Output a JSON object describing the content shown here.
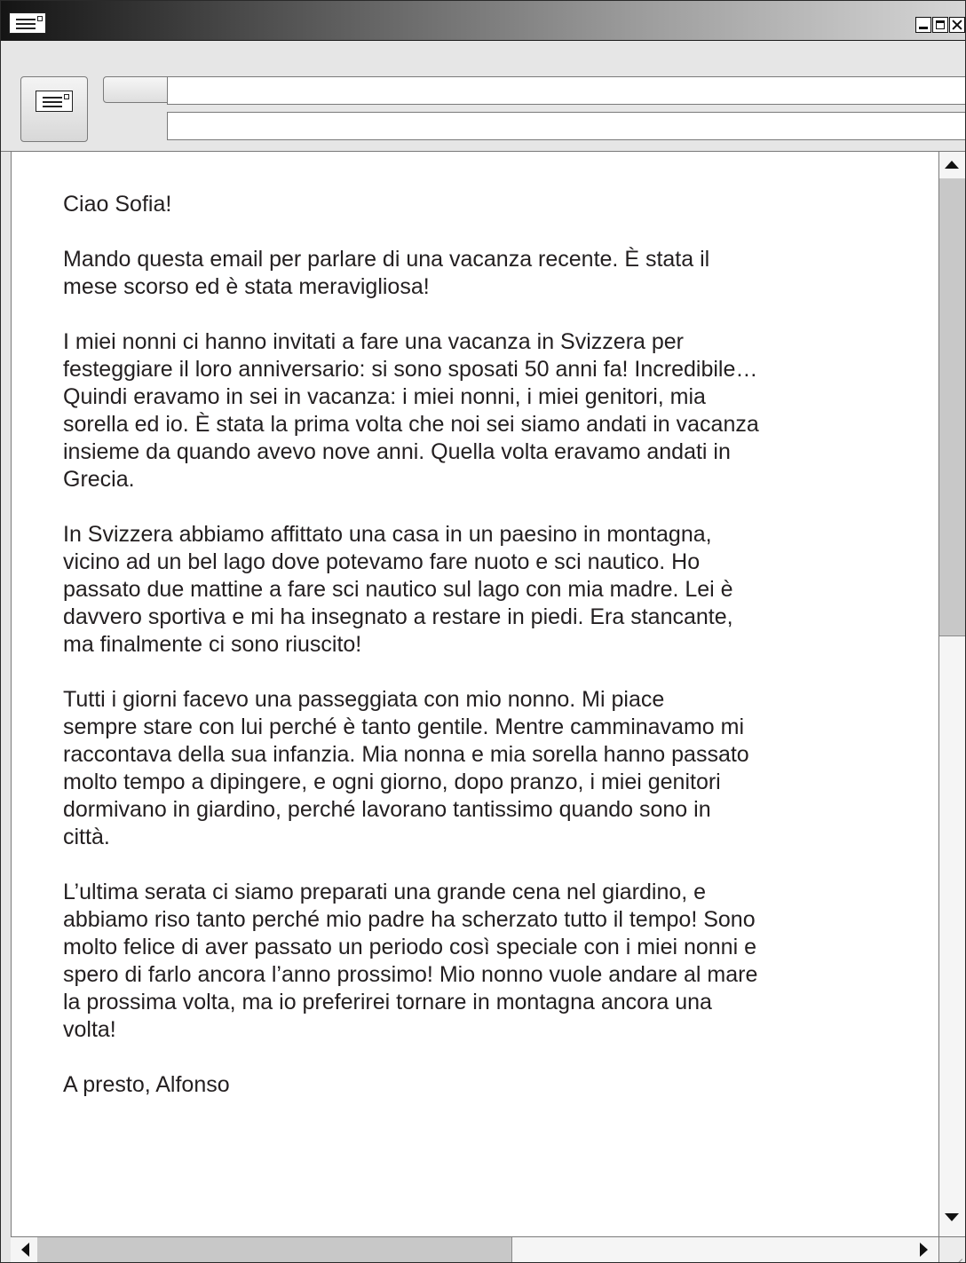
{
  "window": {
    "title": ""
  },
  "header": {
    "to_value": "",
    "subject_value": ""
  },
  "email": {
    "paragraphs": [
      "Ciao Sofia!",
      "Mando questa email per parlare di una vacanza recente. È stata il\nmese scorso ed è stata meravigliosa!",
      "I miei nonni ci hanno invitati a fare una vacanza in Svizzera per\nfesteggiare il loro anniversario: si sono sposati 50 anni fa! Incredibile…\nQuindi eravamo in sei in vacanza: i miei nonni, i miei genitori, mia\nsorella ed io. È stata la prima volta che noi sei siamo andati in vacanza\ninsieme da quando avevo nove anni. Quella volta eravamo andati in\nGrecia.",
      "In Svizzera abbiamo affittato una casa in un paesino in montagna,\nvicino ad un bel lago dove potevamo fare nuoto e sci nautico. Ho\npassato due mattine a fare sci nautico sul lago con mia madre. Lei è\ndavvero sportiva e mi ha insegnato a restare in piedi. Era stancante,\nma finalmente ci sono riuscito!",
      "Tutti i giorni facevo una passeggiata con mio nonno. Mi piace\nsempre stare con lui perché è tanto gentile. Mentre camminavamo mi\nraccontava della sua infanzia. Mia nonna e mia sorella hanno passato\nmolto tempo a dipingere, e ogni giorno, dopo pranzo, i miei genitori\ndormivano in giardino, perché lavorano tantissimo quando sono in\ncittà.",
      "L’ultima serata ci siamo preparati una grande cena nel giardino, e\nabbiamo riso tanto perché mio padre ha scherzato tutto il tempo! Sono\nmolto felice di aver passato un periodo così speciale con i miei nonni e\nspero di farlo ancora l’anno prossimo! Mio nonno vuole andare al mare\nla prossima volta, ma io preferirei tornare in montagna ancora una\nvolta!",
      "A presto, Alfonso"
    ]
  },
  "icons": {
    "app": "envelope-icon",
    "send": "envelope-icon",
    "minimize": "minimize-icon",
    "maximize": "maximize-icon",
    "close": "close-icon"
  },
  "colors": {
    "text": "#231f20",
    "chrome": "#e6e6e6",
    "scroll_thumb": "#c8c8c8"
  }
}
